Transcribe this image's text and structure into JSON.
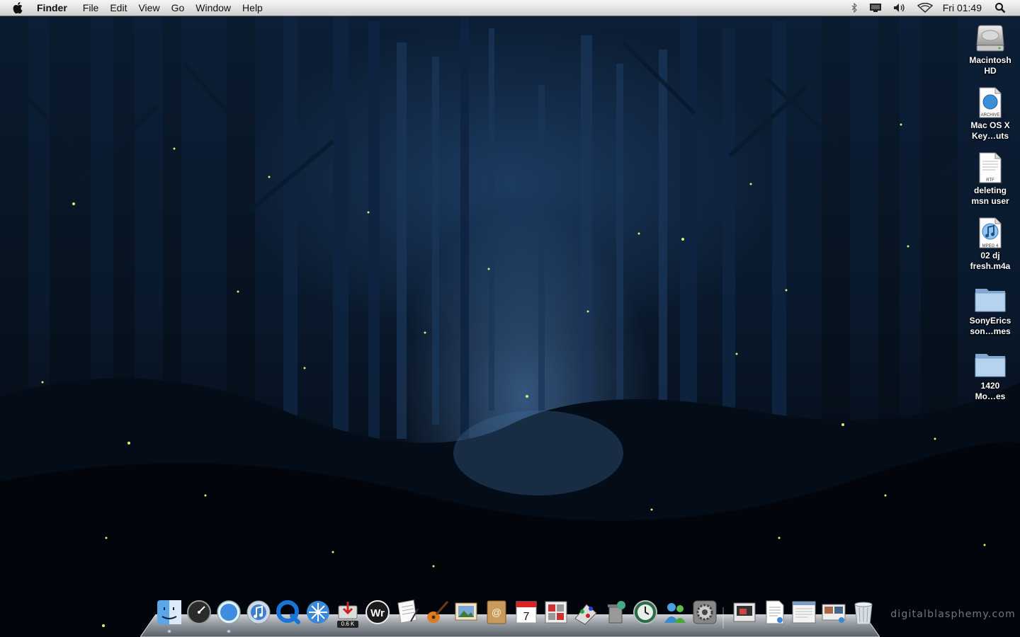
{
  "menubar": {
    "app_name": "Finder",
    "menus": [
      "File",
      "Edit",
      "View",
      "Go",
      "Window",
      "Help"
    ],
    "status_icons": [
      "bluetooth-icon",
      "display-icon",
      "volume-icon",
      "wifi-icon"
    ],
    "clock": "Fri 01:49",
    "search_icon": "spotlight-icon"
  },
  "desktop": {
    "icons": [
      {
        "line1": "Macintosh",
        "line2": "HD",
        "type": "hard-drive"
      },
      {
        "line1": "Mac OS X",
        "line2": "Key…uts",
        "type": "archive",
        "tag": "ARCHIVE"
      },
      {
        "line1": "deleting",
        "line2": "msn user",
        "type": "rtf-document",
        "tag": "RTF"
      },
      {
        "line1": "02 dj",
        "line2": "fresh.m4a",
        "type": "audio",
        "tag": "MPEG 4"
      },
      {
        "line1": "SonyErics",
        "line2": "son…mes",
        "type": "folder"
      },
      {
        "line1": "1420",
        "line2": "Mo…es",
        "type": "folder"
      }
    ]
  },
  "dock": {
    "items": [
      {
        "name": "finder",
        "running": true
      },
      {
        "name": "dashboard",
        "running": false
      },
      {
        "name": "safari",
        "running": true
      },
      {
        "name": "itunes",
        "running": false
      },
      {
        "name": "quicktime",
        "running": false
      },
      {
        "name": "airport-utility",
        "running": false
      },
      {
        "name": "download-monitor",
        "running": false,
        "badge": "0.6 K"
      },
      {
        "name": "wr-app",
        "running": false
      },
      {
        "name": "textedit",
        "running": false
      },
      {
        "name": "garageband",
        "running": false
      },
      {
        "name": "iphoto",
        "running": false
      },
      {
        "name": "address-book",
        "running": false
      },
      {
        "name": "ical",
        "running": false,
        "date": "7"
      },
      {
        "name": "photo-booth",
        "running": false
      },
      {
        "name": "chess",
        "running": false
      },
      {
        "name": "trash-utility",
        "running": false
      },
      {
        "name": "time-machine",
        "running": false
      },
      {
        "name": "messenger",
        "running": false
      },
      {
        "name": "system-preferences",
        "running": false
      },
      {
        "name": "stack-1",
        "running": false
      },
      {
        "name": "stack-2",
        "running": false
      },
      {
        "name": "stack-3",
        "running": false
      },
      {
        "name": "stack-4",
        "running": false
      },
      {
        "name": "trash",
        "running": false
      }
    ]
  },
  "watermark": "digitalblasphemy.com",
  "colors": {
    "menubar": "#e3e3e3",
    "folder": "#a9c9e8",
    "sky": "#0c1f36"
  }
}
